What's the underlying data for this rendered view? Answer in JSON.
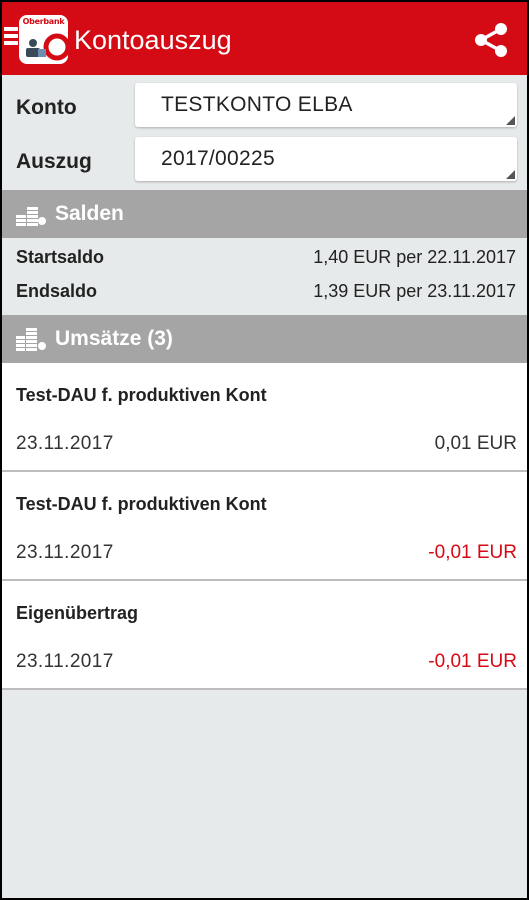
{
  "appbar": {
    "title": "Kontoauszug",
    "logo_text": "Oberbank",
    "brand_color": "#d40a14",
    "icons": [
      "menu-icon",
      "oberbank-logo",
      "share-icon"
    ]
  },
  "form": {
    "konto_label": "Konto",
    "konto_value": "TESTKONTO ELBA",
    "auszug_label": "Auszug",
    "auszug_value": "2017/00225"
  },
  "salden": {
    "title": "Salden",
    "icon": "coins-icon",
    "rows": [
      {
        "label": "Startsaldo",
        "amount": "1,40 EUR per 22.11.2017"
      },
      {
        "label": "Endsaldo",
        "amount": "1,39 EUR per 23.11.2017"
      }
    ]
  },
  "umsaetze": {
    "title": "Umsätze (3)",
    "icon": "stacked-coins-icon",
    "negative_color": "#d40a14",
    "items": [
      {
        "description": "Test-DAU f. produktiven Kont",
        "date": "23.11.2017",
        "amount": "0,01 EUR",
        "negative": false
      },
      {
        "description": "Test-DAU f. produktiven Kont",
        "date": "23.11.2017",
        "amount": "-0,01 EUR",
        "negative": true
      },
      {
        "description": "Eigenübertrag",
        "date": "23.11.2017",
        "amount": "-0,01 EUR",
        "negative": true
      }
    ]
  }
}
